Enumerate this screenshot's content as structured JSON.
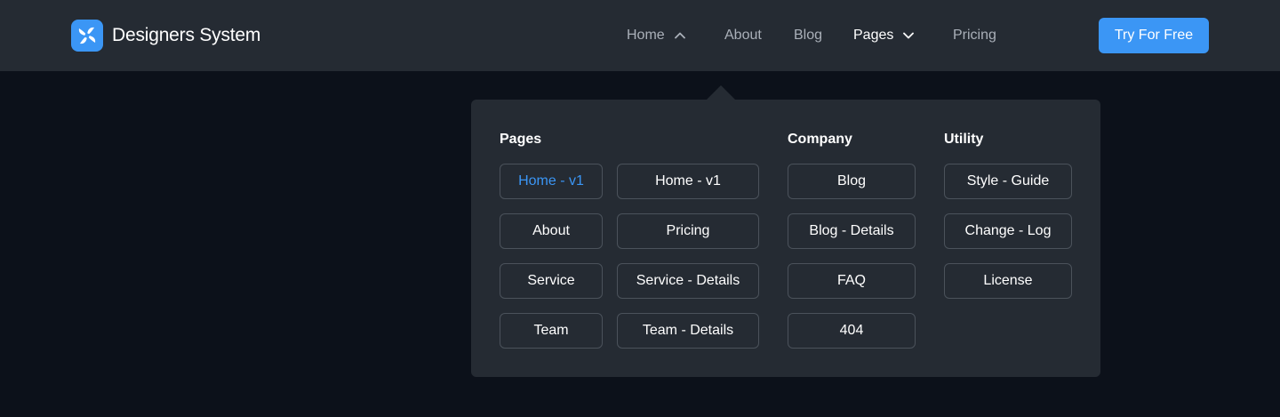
{
  "brand": {
    "name": "Designers System",
    "logo_icon": "pinwheel-logo-icon"
  },
  "nav": {
    "items": [
      {
        "label": "Home",
        "icon": "chevron-up-icon"
      },
      {
        "label": "About"
      },
      {
        "label": "Blog"
      },
      {
        "label": "Pages",
        "icon": "chevron-down-icon",
        "active": true
      },
      {
        "label": "Pricing"
      }
    ],
    "cta_label": "Try For Free"
  },
  "colors": {
    "accent": "#3b96f5",
    "navbar_bg": "#252b33",
    "page_bg": "#0c111a",
    "nav_text": "#aab0b9",
    "button_border": "#4b525b"
  },
  "mega_menu": {
    "pages": {
      "title": "Pages",
      "items": [
        "Home - v1",
        "Home - v1",
        "About",
        "Pricing",
        "Service",
        "Service - Details",
        "Team",
        "Team - Details"
      ]
    },
    "company": {
      "title": "Company",
      "items": [
        "Blog",
        "Blog - Details",
        "FAQ",
        "404"
      ]
    },
    "utility": {
      "title": "Utility",
      "items": [
        "Style - Guide",
        "Change - Log",
        "License"
      ]
    }
  }
}
